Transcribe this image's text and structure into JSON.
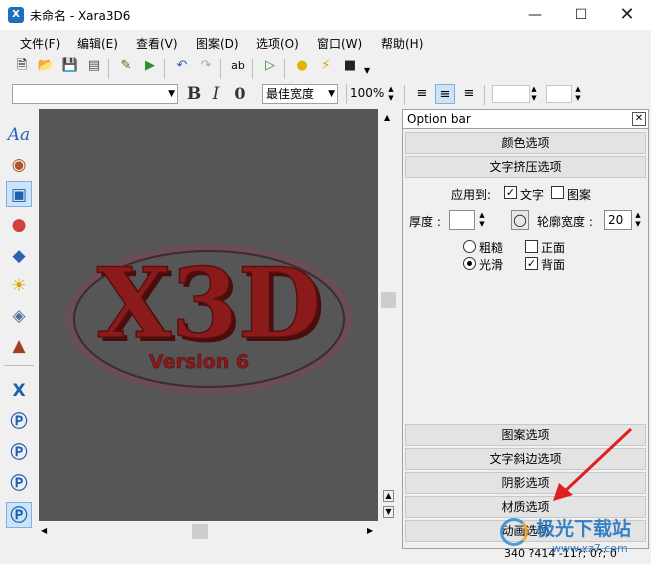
{
  "window": {
    "title": "未命名 - Xara3D6",
    "app_icon": "xara3d-app-icon"
  },
  "menubar": [
    "文件(F)",
    "编辑(E)",
    "查看(V)",
    "图案(D)",
    "选项(O)",
    "窗口(W)",
    "帮助(H)"
  ],
  "toolbar2": {
    "font_combo_value": "",
    "bold": "B",
    "italic": "I",
    "outline": "0",
    "width_mode_value": "最佳宽度",
    "zoom_value": "100%"
  },
  "canvas": {
    "logo_text": "X3D",
    "version_text": "Version 6",
    "colors": {
      "background": "#565656",
      "logo_fill": "#8b1a1a",
      "logo_dark": "#4a0c0c"
    }
  },
  "option_bar": {
    "title": "Option bar",
    "close": "✕",
    "sections_top": [
      "颜色选项",
      "文字挤压选项"
    ],
    "extrude": {
      "apply_to_label": "应用到:",
      "apply_text_label": "文字",
      "apply_text_checked": true,
      "apply_pattern_label": "图案",
      "apply_pattern_checked": false,
      "depth_label": "厚度 :",
      "depth_value": "",
      "outline_width_label": "轮廓宽度 :",
      "outline_width_value": "20",
      "rough_label": "粗糙",
      "smooth_label": "光滑",
      "smooth_selected": true,
      "front_label": "正面",
      "front_checked": false,
      "back_label": "背面",
      "back_checked": true
    },
    "sections_bottom": [
      "图案选项",
      "文字斜边选项",
      "阴影选项",
      "材质选项",
      "动画选项"
    ]
  },
  "statusbar": {
    "coords": "340 ?414 -11?; 0?; 0"
  },
  "watermark": {
    "text": "极光下载站",
    "url": "www.xz7.com"
  }
}
